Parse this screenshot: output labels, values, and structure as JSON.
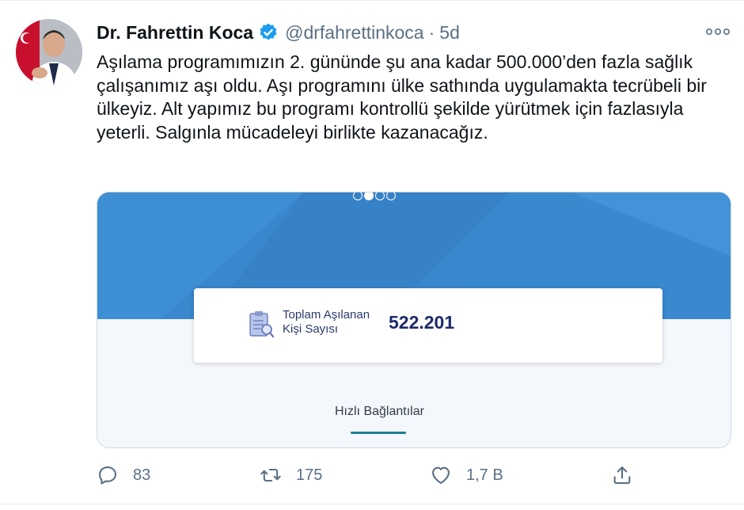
{
  "tweet": {
    "author_name": "Dr. Fahrettin Koca",
    "handle": "@drfahrettinkoca",
    "separator": "·",
    "time": "5d",
    "text": "Aşılama programımızın 2. gününde şu ana kadar 500.000’den fazla sağlık çalışanımız aşı oldu. Aşı programını ülke sathında uygulamakta tecrübeli bir ülkeyiz. Alt yapımız bu programı kontrollü şekilde yürütmek için fazlasıyla yeterli. Salgınla mücadeleyi birlikte kazanacağız."
  },
  "media": {
    "carousel": {
      "total": 4,
      "active_index": 1
    },
    "card": {
      "label": "Toplam Aşılanan Kişi Sayısı",
      "value": "522.201"
    },
    "quick_links_label": "Hızlı Bağlantılar",
    "colors": {
      "banner": "#3a87cd",
      "accent": "#1b7f8c"
    }
  },
  "actions": {
    "reply_count": "83",
    "retweet_count": "175",
    "like_count": "1,7 B"
  },
  "icons": [
    "verified-badge-icon",
    "more-icon",
    "reply-icon",
    "retweet-icon",
    "like-icon",
    "share-icon",
    "clipboard-icon"
  ]
}
